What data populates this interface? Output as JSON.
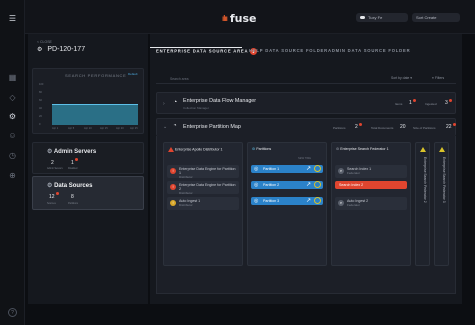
{
  "app": {
    "logo_mark": "ılıı",
    "logo_text": "fuse"
  },
  "topbar": {
    "pill1_label": "Tuxy Fe",
    "pill2_label": "Sort Create"
  },
  "sidebar": {
    "breadcrumb": "< CLOSE",
    "title": "PD-120-177",
    "perf_title": "SEARCH PERFORMANCE",
    "perf_badge": "Default",
    "perf_y_ticks": [
      "100",
      "80",
      "60",
      "40",
      "20",
      "0"
    ],
    "perf_x_ticks": [
      "Apr 1",
      "Apr 5",
      "Apr 10",
      "Apr 15",
      "Apr 20",
      "Apr 25"
    ],
    "admin_servers": {
      "label": "Admin Servers",
      "count1": "2",
      "count1_label": "Admin Servers",
      "count2": "1",
      "count2_label": "Disabled"
    },
    "data_sources": {
      "label": "Data Sources",
      "count1": "12",
      "count1_label": "Sources",
      "count2": "8",
      "count2_label": "Partitions"
    }
  },
  "tabs": [
    {
      "label": "ENTERPRISE DATA SOURCE AREA",
      "badge": "1"
    },
    {
      "label": "HELP DATA SOURCE FOLDER"
    },
    {
      "label": "ADMIN DATA SOURCE FOLDER"
    }
  ],
  "toolbar": {
    "search_placeholder": "Search area",
    "select_value": "Sort by date",
    "filter_label": "Filters"
  },
  "flow_manager": {
    "label": "Enterprise Data Flow Manager",
    "sub": "Collection Manager",
    "stat1_label": "Items",
    "stat1": "1",
    "stat2_label": "Ingested",
    "stat2": "3"
  },
  "partition_map": {
    "label": "Enterprise Partition Map",
    "stat1_label": "Partitions",
    "stat1": "2",
    "stat2_label": "Total Documents",
    "stat2": "20",
    "stat3_label": "Size of Partitions",
    "stat3": "22"
  },
  "columns": [
    {
      "title": "Enterprise Apollo Distributor 1",
      "items": [
        {
          "label": "Enterprise Data Engine for Partition 1",
          "sub": "Distributor"
        },
        {
          "label": "Enterprise Data Engine for Partition 2",
          "sub": "Distributor"
        },
        {
          "label": "Auto Ingest 1",
          "sub": "Distributor"
        }
      ]
    },
    {
      "title": "Partitions",
      "sub": "NEW TIME",
      "items": [
        {
          "label": "Partition 1",
          "sub": "Distributor"
        },
        {
          "label": "Partition 2",
          "sub": "Distributor"
        },
        {
          "label": "Partition 3",
          "sub": "Distributor"
        }
      ]
    },
    {
      "title": "Enterprise Search Federator 1",
      "items": [
        {
          "label": "Search Index 1",
          "sub": "Federator"
        },
        {
          "label": "Search Index 2",
          "sub": "Federator"
        },
        {
          "label": "Auto Ingest 2",
          "sub": "Federator"
        }
      ]
    }
  ],
  "vertical_cols": [
    {
      "label": "Enterprise Search Federator 2"
    },
    {
      "label": "Enterprise Search Federator 3"
    }
  ],
  "colors": {
    "accent_red": "#e0452f",
    "accent_blue": "#2b82c9",
    "accent_yellow": "#d9c32a",
    "teal_fill": "#2a6f86"
  }
}
